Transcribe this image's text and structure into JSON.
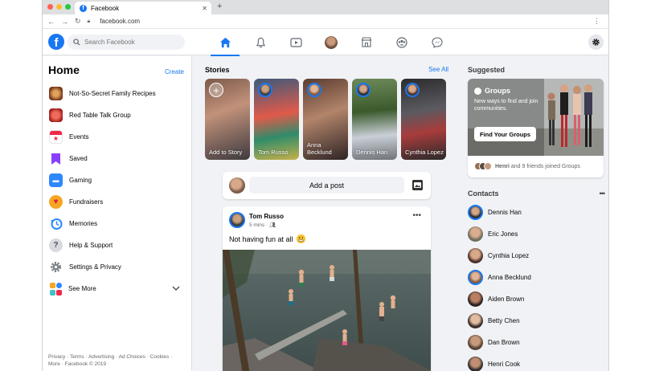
{
  "browser": {
    "tab_title": "Facebook",
    "url": "facebook.com"
  },
  "header": {
    "search_placeholder": "Search Facebook",
    "nav": [
      "home-icon",
      "bell-icon",
      "watch-icon",
      "profile-avatar",
      "marketplace-icon",
      "groups-icon",
      "messenger-icon"
    ],
    "accent": "#1877f2"
  },
  "left": {
    "title": "Home",
    "create": "Create",
    "items": [
      {
        "label": "Not-So-Secret Family Recipes",
        "icon": "group-photo-icon"
      },
      {
        "label": "Red Table Talk Group",
        "icon": "group-photo-icon"
      },
      {
        "label": "Events",
        "icon": "calendar-icon"
      },
      {
        "label": "Saved",
        "icon": "bookmark-icon"
      },
      {
        "label": "Gaming",
        "icon": "gaming-icon"
      },
      {
        "label": "Fundraisers",
        "icon": "heart-icon"
      },
      {
        "label": "Memories",
        "icon": "clock-icon"
      },
      {
        "label": "Help & Support",
        "icon": "question-icon"
      },
      {
        "label": "Settings & Privacy",
        "icon": "gear-icon"
      },
      {
        "label": "See More",
        "icon": "grid-icon"
      }
    ],
    "footer_line1": "Privacy · Terms · Advertising · Ad Choices · Cookies ·",
    "footer_line2": "More · Facebook © 2019"
  },
  "stories": {
    "title": "Stories",
    "see_all": "See All",
    "items": [
      {
        "name": "Add to Story"
      },
      {
        "name": "Tom Russo"
      },
      {
        "name": "Anna Becklund"
      },
      {
        "name": "Dennis Han"
      },
      {
        "name": "Cynthia Lopez"
      }
    ]
  },
  "composer": {
    "add_post": "Add a post"
  },
  "post": {
    "author": "Tom Russo",
    "time": "5 mins ·",
    "text": "Not having fun at all"
  },
  "right": {
    "suggested_title": "Suggested",
    "groups_title": "Groups",
    "groups_subtitle": "New ways to find and join communities.",
    "find_groups": "Find Your Groups",
    "groups_footer_name": "Henri",
    "groups_footer_rest": "and 9 friends joined Groups",
    "contacts_title": "Contacts",
    "contacts": [
      {
        "name": "Dennis Han"
      },
      {
        "name": "Eric Jones"
      },
      {
        "name": "Cynthia Lopez"
      },
      {
        "name": "Anna Becklund"
      },
      {
        "name": "Aiden Brown"
      },
      {
        "name": "Betty Chen"
      },
      {
        "name": "Dan Brown"
      },
      {
        "name": "Henri Cook"
      }
    ]
  }
}
